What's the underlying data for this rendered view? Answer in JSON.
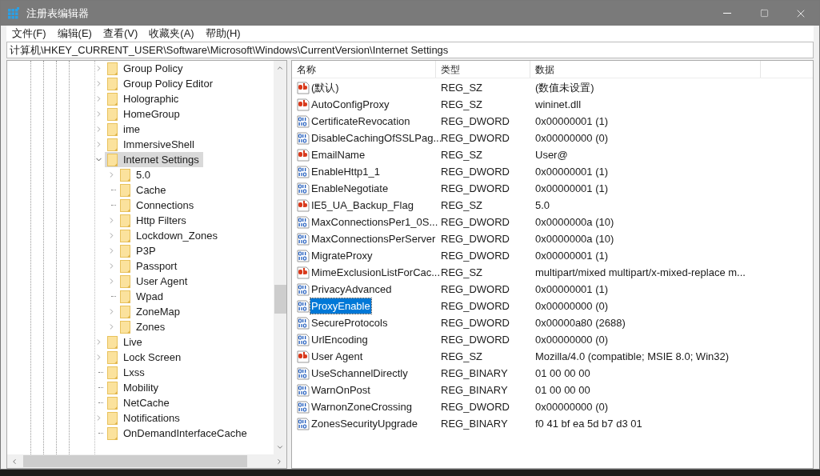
{
  "window": {
    "title": "注册表编辑器"
  },
  "menu": [
    "文件(F)",
    "编辑(E)",
    "查看(V)",
    "收藏夹(A)",
    "帮助(H)"
  ],
  "address": "计算机\\HKEY_CURRENT_USER\\Software\\Microsoft\\Windows\\CurrentVersion\\Internet Settings",
  "tree": [
    {
      "label": "Group Policy",
      "expandable": true,
      "expanded": false,
      "selected": false
    },
    {
      "label": "Group Policy Editor",
      "expandable": true,
      "expanded": false,
      "selected": false
    },
    {
      "label": "Holographic",
      "expandable": true,
      "expanded": false,
      "selected": false
    },
    {
      "label": "HomeGroup",
      "expandable": true,
      "expanded": false,
      "selected": false
    },
    {
      "label": "ime",
      "expandable": true,
      "expanded": false,
      "selected": false
    },
    {
      "label": "ImmersiveShell",
      "expandable": true,
      "expanded": false,
      "selected": false
    },
    {
      "label": "Internet Settings",
      "expandable": true,
      "expanded": true,
      "selected": true,
      "children": [
        {
          "label": "5.0",
          "expandable": true,
          "expanded": false,
          "selected": false
        },
        {
          "label": "Cache",
          "expandable": false,
          "selected": false
        },
        {
          "label": "Connections",
          "expandable": false,
          "selected": false
        },
        {
          "label": "Http Filters",
          "expandable": true,
          "expanded": false,
          "selected": false
        },
        {
          "label": "Lockdown_Zones",
          "expandable": true,
          "expanded": false,
          "selected": false
        },
        {
          "label": "P3P",
          "expandable": true,
          "expanded": false,
          "selected": false
        },
        {
          "label": "Passport",
          "expandable": true,
          "expanded": false,
          "selected": false
        },
        {
          "label": "User Agent",
          "expandable": true,
          "expanded": false,
          "selected": false
        },
        {
          "label": "Wpad",
          "expandable": false,
          "selected": false
        },
        {
          "label": "ZoneMap",
          "expandable": true,
          "expanded": false,
          "selected": false
        },
        {
          "label": "Zones",
          "expandable": true,
          "expanded": false,
          "selected": false
        }
      ]
    },
    {
      "label": "Live",
      "expandable": true,
      "expanded": false,
      "selected": false
    },
    {
      "label": "Lock Screen",
      "expandable": true,
      "expanded": false,
      "selected": false
    },
    {
      "label": "Lxss",
      "expandable": false,
      "selected": false
    },
    {
      "label": "Mobility",
      "expandable": false,
      "selected": false
    },
    {
      "label": "NetCache",
      "expandable": false,
      "selected": false
    },
    {
      "label": "Notifications",
      "expandable": true,
      "expanded": false,
      "selected": false
    },
    {
      "label": "OnDemandInterfaceCache",
      "expandable": false,
      "selected": false
    }
  ],
  "table": {
    "columns": [
      "名称",
      "类型",
      "数据"
    ],
    "rows": [
      {
        "kind": "string",
        "name": "(默认)",
        "type": "REG_SZ",
        "data": "(数值未设置)",
        "selected": false
      },
      {
        "kind": "string",
        "name": "AutoConfigProxy",
        "type": "REG_SZ",
        "data": "wininet.dll",
        "selected": false
      },
      {
        "kind": "binary",
        "name": "CertificateRevocation",
        "type": "REG_DWORD",
        "data": "0x00000001 (1)",
        "selected": false
      },
      {
        "kind": "binary",
        "name": "DisableCachingOfSSLPag...",
        "type": "REG_DWORD",
        "data": "0x00000000 (0)",
        "selected": false
      },
      {
        "kind": "string",
        "name": "EmailName",
        "type": "REG_SZ",
        "data": "User@",
        "selected": false
      },
      {
        "kind": "binary",
        "name": "EnableHttp1_1",
        "type": "REG_DWORD",
        "data": "0x00000001 (1)",
        "selected": false
      },
      {
        "kind": "binary",
        "name": "EnableNegotiate",
        "type": "REG_DWORD",
        "data": "0x00000001 (1)",
        "selected": false
      },
      {
        "kind": "string",
        "name": "IE5_UA_Backup_Flag",
        "type": "REG_SZ",
        "data": "5.0",
        "selected": false
      },
      {
        "kind": "binary",
        "name": "MaxConnectionsPer1_0S...",
        "type": "REG_DWORD",
        "data": "0x0000000a (10)",
        "selected": false
      },
      {
        "kind": "binary",
        "name": "MaxConnectionsPerServer",
        "type": "REG_DWORD",
        "data": "0x0000000a (10)",
        "selected": false
      },
      {
        "kind": "binary",
        "name": "MigrateProxy",
        "type": "REG_DWORD",
        "data": "0x00000001 (1)",
        "selected": false
      },
      {
        "kind": "string",
        "name": "MimeExclusionListForCac...",
        "type": "REG_SZ",
        "data": "multipart/mixed multipart/x-mixed-replace m...",
        "selected": false
      },
      {
        "kind": "binary",
        "name": "PrivacyAdvanced",
        "type": "REG_DWORD",
        "data": "0x00000001 (1)",
        "selected": false
      },
      {
        "kind": "binary",
        "name": "ProxyEnable",
        "type": "REG_DWORD",
        "data": "0x00000000 (0)",
        "selected": true
      },
      {
        "kind": "binary",
        "name": "SecureProtocols",
        "type": "REG_DWORD",
        "data": "0x00000a80 (2688)",
        "selected": false
      },
      {
        "kind": "binary",
        "name": "UrlEncoding",
        "type": "REG_DWORD",
        "data": "0x00000000 (0)",
        "selected": false
      },
      {
        "kind": "string",
        "name": "User Agent",
        "type": "REG_SZ",
        "data": "Mozilla/4.0 (compatible; MSIE 8.0; Win32)",
        "selected": false
      },
      {
        "kind": "binary",
        "name": "UseSchannelDirectly",
        "type": "REG_BINARY",
        "data": "01 00 00 00",
        "selected": false
      },
      {
        "kind": "binary",
        "name": "WarnOnPost",
        "type": "REG_BINARY",
        "data": "01 00 00 00",
        "selected": false
      },
      {
        "kind": "binary",
        "name": "WarnonZoneCrossing",
        "type": "REG_DWORD",
        "data": "0x00000000 (0)",
        "selected": false
      },
      {
        "kind": "binary",
        "name": "ZonesSecurityUpgrade",
        "type": "REG_BINARY",
        "data": "f0 41 bf ea 5d b7 d3 01",
        "selected": false
      }
    ]
  }
}
